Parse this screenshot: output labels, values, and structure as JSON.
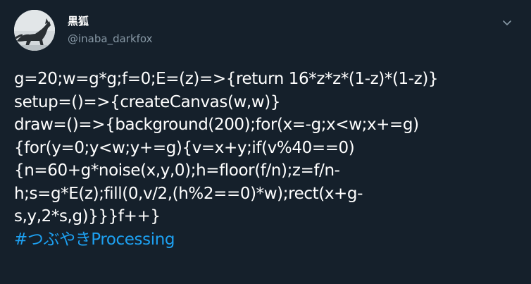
{
  "user": {
    "display_name": "黒狐",
    "handle": "@inaba_darkfox",
    "avatar_icon": "fox-silhouette-avatar"
  },
  "menu": {
    "icon": "chevron-down-icon"
  },
  "tweet": {
    "lines": [
      "g=20;w=g*g;f=0;E=(z)=>{return 16*z*z*(1-z)*(1-z)}",
      "setup=()=>{createCanvas(w,w)}",
      "draw=()=>{background(200);for(x=-g;x<w;x+=g)",
      "{for(y=0;y<w;y+=g){v=x+y;if(v%40==0)",
      "{n=60+g*noise(x,y,0);h=floor(f/n);z=f/n-",
      "h;s=g*E(z);fill(0,v/2,(h%2==0)*w);rect(x+g-",
      "s,y,2*s,g)}}}f++}"
    ],
    "hashtag": "#つぶやきProcessing"
  },
  "colors": {
    "background": "#15202b",
    "text": "#ffffff",
    "secondary": "#8899a6",
    "link": "#1da1f2"
  }
}
